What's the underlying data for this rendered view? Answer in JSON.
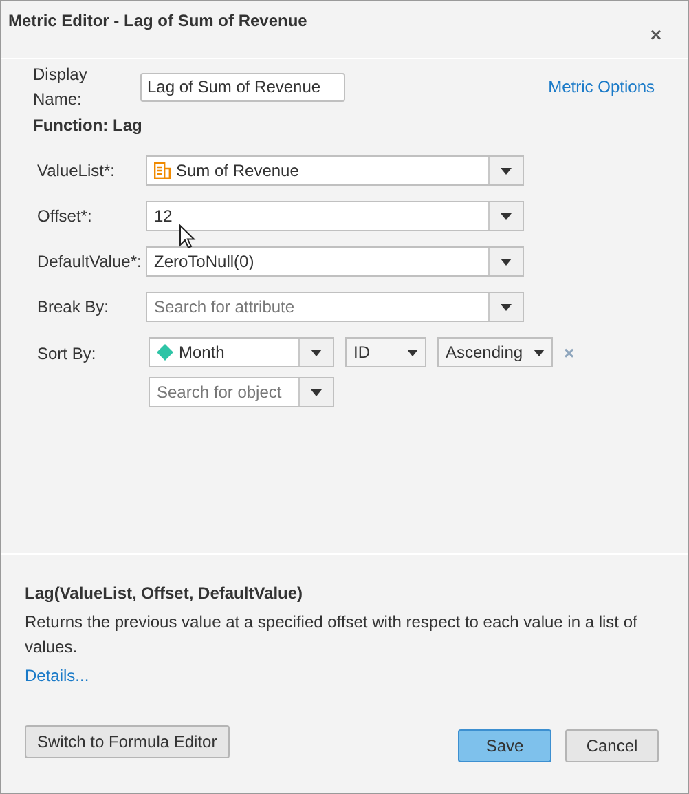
{
  "window": {
    "title": "Metric Editor - Lag of Sum of Revenue",
    "close": "×"
  },
  "display_name": {
    "label": "Display Name:",
    "value": "Lag of Sum of Revenue"
  },
  "metric_options": "Metric Options",
  "function_label": "Function: Lag",
  "fields": [
    {
      "label": "ValueList*:",
      "kind": "metric",
      "value": "Sum of Revenue"
    },
    {
      "label": "Offset*:",
      "kind": "value",
      "value": "12"
    },
    {
      "label": "DefaultValue*:",
      "kind": "value",
      "value": "ZeroToNull(0)"
    },
    {
      "label": "Break By:",
      "kind": "search",
      "placeholder": "Search for attribute"
    }
  ],
  "sort_by": {
    "label": "Sort By:",
    "attribute": "Month",
    "form": "ID",
    "order": "Ascending",
    "remove": "×",
    "search_placeholder": "Search for object"
  },
  "help": {
    "signature": "Lag(ValueList, Offset, DefaultValue)",
    "description": "Returns the previous value at a specified offset with respect to each value in a list of values.",
    "details": "Details..."
  },
  "buttons": {
    "switch": "Switch to Formula Editor",
    "save": "Save",
    "cancel": "Cancel"
  }
}
